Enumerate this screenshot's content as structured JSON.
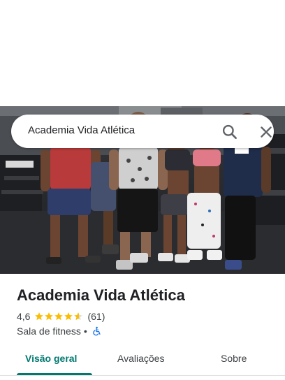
{
  "search": {
    "query": "Academia Vida Atlética",
    "search_icon": "search-icon",
    "close_icon": "close-icon"
  },
  "place": {
    "name": "Academia Vida Atlética",
    "rating": "4,6",
    "rating_value": 4.6,
    "stars_total": 5,
    "review_count": "(61)",
    "category": "Sala de fitness",
    "separator": "•",
    "accessibility_icon": "wheelchair-icon"
  },
  "tabs": [
    {
      "label": "Visão geral",
      "active": true
    },
    {
      "label": "Avaliações",
      "active": false
    },
    {
      "label": "Sobre",
      "active": false
    }
  ],
  "colors": {
    "accent": "#01796f",
    "star": "#fbbc04",
    "accessibility": "#1a73e8"
  }
}
